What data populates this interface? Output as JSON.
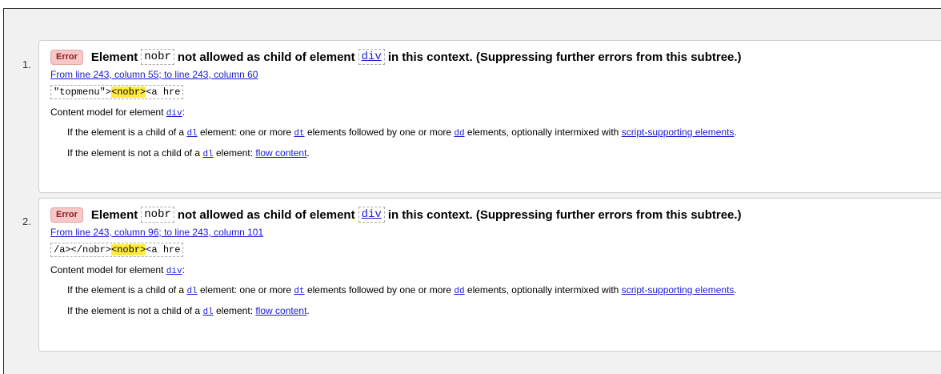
{
  "errors": [
    {
      "index": "1.",
      "badge": "Error",
      "title": {
        "part1": "Element",
        "code1": "nobr",
        "part2": "not allowed as child of element",
        "code2": "div",
        "part3": "in this context. (Suppressing further errors from this subtree.)"
      },
      "location": "From line 243, column 55; to line 243, column 60",
      "extract": {
        "pre": "\"topmenu\">",
        "highlight": "<nobr>",
        "post": "<a hre"
      },
      "content_model": {
        "label": "Content model for element",
        "element": "div",
        "suffix": ":"
      },
      "rules": [
        {
          "t1": "If the element is a child of a",
          "c1": "dl",
          "t2": "element: one or more",
          "c2": "dt",
          "t3": "elements followed by one or more",
          "c3": "dd",
          "t4": "elements, optionally intermixed with",
          "link": "script-supporting elements",
          "t5": "."
        },
        {
          "t1": "If the element is not a child of a",
          "c1": "dl",
          "t2": "element:",
          "link": "flow content",
          "t3": "."
        }
      ]
    },
    {
      "index": "2.",
      "badge": "Error",
      "title": {
        "part1": "Element",
        "code1": "nobr",
        "part2": "not allowed as child of element",
        "code2": "div",
        "part3": "in this context. (Suppressing further errors from this subtree.)"
      },
      "location": "From line 243, column 96; to line 243, column 101",
      "extract": {
        "pre": "/a></nobr>",
        "highlight": "<nobr>",
        "post": "<a hre"
      },
      "content_model": {
        "label": "Content model for element",
        "element": "div",
        "suffix": ":"
      },
      "rules": [
        {
          "t1": "If the element is a child of a",
          "c1": "dl",
          "t2": "element: one or more",
          "c2": "dt",
          "t3": "elements followed by one or more",
          "c3": "dd",
          "t4": "elements, optionally intermixed with",
          "link": "script-supporting elements",
          "t5": "."
        },
        {
          "t1": "If the element is not a child of a",
          "c1": "dl",
          "t2": "element:",
          "link": "flow content",
          "t3": "."
        }
      ]
    }
  ],
  "colors": {
    "link": "#1a1ad9",
    "badge_bg": "#f6c8c8",
    "highlight": "#ffeb3b"
  }
}
